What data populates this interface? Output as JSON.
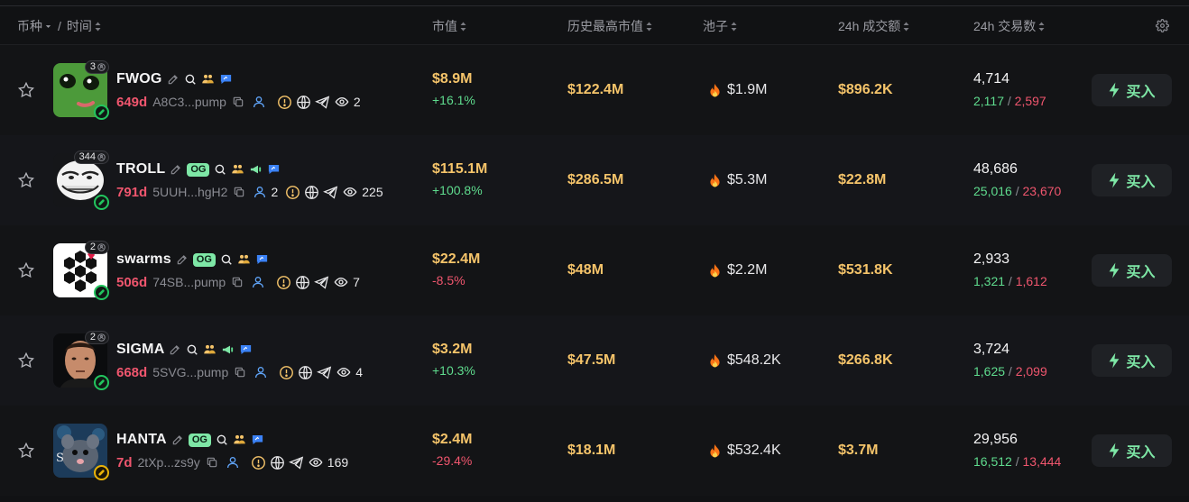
{
  "header": {
    "token_label": "币种",
    "separator": "/",
    "time_label": "时间",
    "mcap_label": "市值",
    "ath_label": "历史最高市值",
    "pool_label": "池子",
    "volume_label": "24h 成交额",
    "txns_label": "24h 交易数"
  },
  "colors": {
    "accent_green": "#7ee7a6",
    "gold": "#f5c46a",
    "red": "#f0566e",
    "up": "#5fdc8e"
  },
  "rows": [
    {
      "symbol": "FWOG",
      "holders_badge": "3",
      "og": false,
      "age": "649d",
      "address": "A8C3...pump",
      "has_user_count": false,
      "user_count": "",
      "views": "2",
      "mcap": "$8.9M",
      "change": "+16.1%",
      "change_dir": "up",
      "ath": "$122.4M",
      "pool": "$1.9M",
      "volume": "$896.2K",
      "txns": "4,714",
      "buys": "2,117",
      "sells": "2,597",
      "buy_label": "买入",
      "platform": "pump"
    },
    {
      "symbol": "TROLL",
      "holders_badge": "344",
      "og": true,
      "og_label": "OG",
      "age": "791d",
      "address": "5UUH...hgH2",
      "has_user_count": true,
      "user_count": "2",
      "views": "225",
      "mcap": "$115.1M",
      "change": "+100.8%",
      "change_dir": "up",
      "ath": "$286.5M",
      "pool": "$5.3M",
      "volume": "$22.8M",
      "txns": "48,686",
      "buys": "25,016",
      "sells": "23,670",
      "buy_label": "买入",
      "platform": "pump"
    },
    {
      "symbol": "swarms",
      "holders_badge": "2",
      "og": true,
      "og_label": "OG",
      "age": "506d",
      "address": "74SB...pump",
      "has_user_count": false,
      "user_count": "",
      "views": "7",
      "mcap": "$22.4M",
      "change": "-8.5%",
      "change_dir": "down",
      "ath": "$48M",
      "pool": "$2.2M",
      "volume": "$531.8K",
      "txns": "2,933",
      "buys": "1,321",
      "sells": "1,612",
      "buy_label": "买入",
      "platform": "pump"
    },
    {
      "symbol": "SIGMA",
      "holders_badge": "2",
      "og": false,
      "age": "668d",
      "address": "5SVG...pump",
      "has_user_count": false,
      "user_count": "",
      "views": "4",
      "mcap": "$3.2M",
      "change": "+10.3%",
      "change_dir": "up",
      "ath": "$47.5M",
      "pool": "$548.2K",
      "volume": "$266.8K",
      "txns": "3,724",
      "buys": "1,625",
      "sells": "2,099",
      "buy_label": "买入",
      "platform": "pump"
    },
    {
      "symbol": "HANTA",
      "holders_badge": "",
      "og": true,
      "og_label": "OG",
      "age": "7d",
      "address": "2tXp...zs9y",
      "has_user_count": false,
      "user_count": "",
      "views": "169",
      "mcap": "$2.4M",
      "change": "-29.4%",
      "change_dir": "down",
      "ath": "$18.1M",
      "pool": "$532.4K",
      "volume": "$3.7M",
      "txns": "29,956",
      "buys": "16,512",
      "sells": "13,444",
      "buy_label": "买入",
      "platform": "other"
    }
  ]
}
